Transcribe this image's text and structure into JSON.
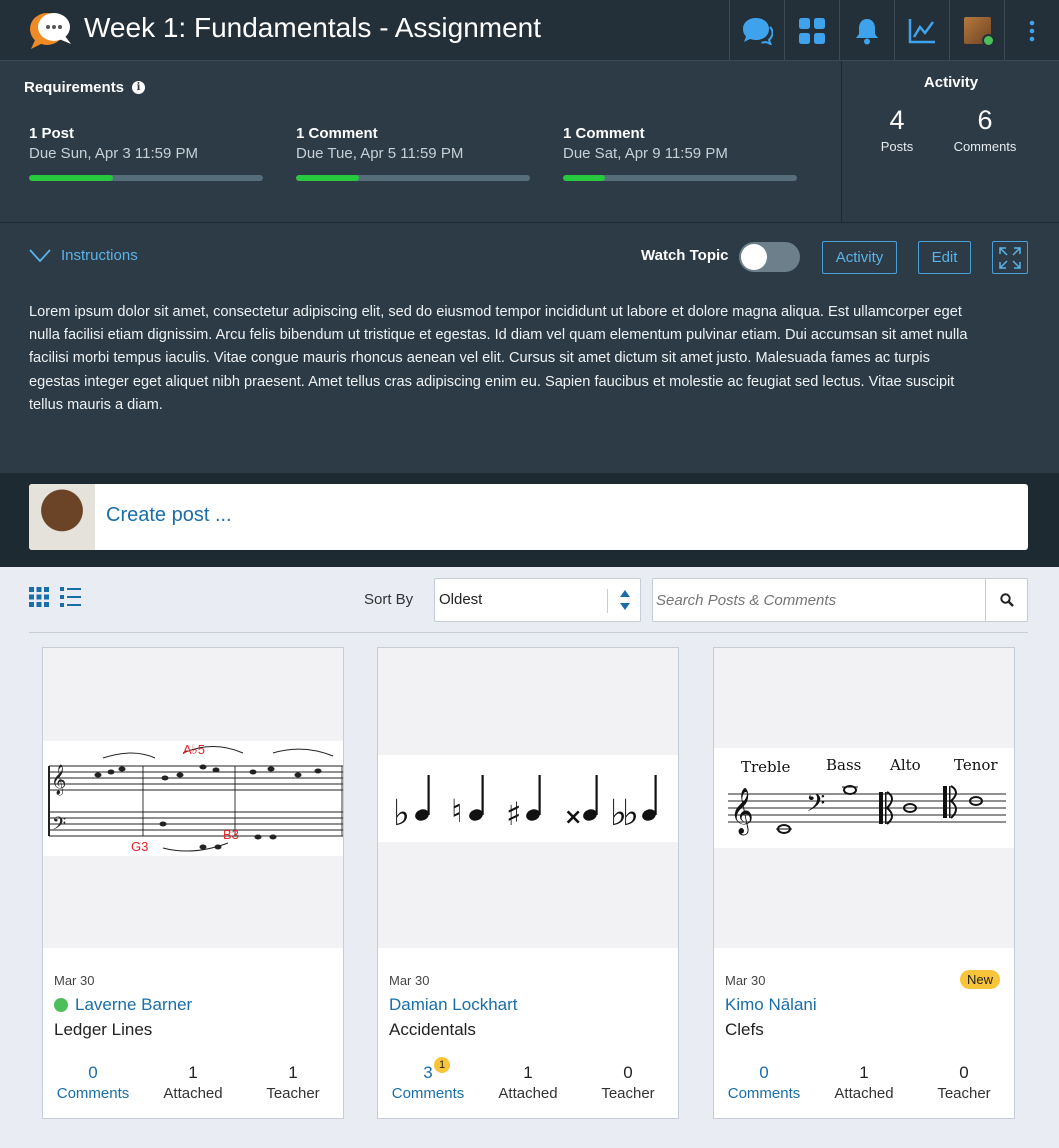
{
  "header": {
    "title": "Week 1: Fundamentals - Assignment",
    "icons": [
      "chat-icon",
      "dashboard-icon",
      "bell-icon",
      "analytics-icon",
      "user-avatar",
      "more-icon"
    ]
  },
  "requirements": {
    "title": "Requirements",
    "items": [
      {
        "name": "1 Post",
        "due": "Due Sun, Apr 3 11:59 PM",
        "progress": 0.36
      },
      {
        "name": "1 Comment",
        "due": "Due Tue, Apr 5 11:59 PM",
        "progress": 0.27
      },
      {
        "name": "1 Comment",
        "due": "Due Sat, Apr 9 11:59 PM",
        "progress": 0.18
      }
    ]
  },
  "activity": {
    "title": "Activity",
    "posts_count": "4",
    "posts_label": "Posts",
    "comments_count": "6",
    "comments_label": "Comments"
  },
  "instructions": {
    "toggle_label": "Instructions",
    "watch_label": "Watch Topic",
    "watch_on": false,
    "activity_button": "Activity",
    "edit_button": "Edit",
    "text": "Lorem ipsum dolor sit amet, consectetur adipiscing elit, sed do eiusmod tempor incididunt ut labore et dolore magna aliqua. Est ullamcorper eget nulla facilisi etiam dignissim. Arcu felis bibendum ut tristique et egestas. Id diam vel quam elementum pulvinar etiam. Dui accumsan sit amet nulla facilisi morbi tempus iaculis. Vitae congue mauris rhoncus aenean vel elit. Cursus sit amet dictum sit amet justo. Malesuada fames ac turpis egestas integer eget aliquet nibh praesent. Amet tellus cras adipiscing enim eu. Sapien faucibus et molestie ac feugiat sed lectus. Vitae suscipit tellus mauris a diam."
  },
  "create_post": {
    "label": "Create post ..."
  },
  "toolbar": {
    "sort_label": "Sort By",
    "sort_value": "Oldest",
    "search_placeholder": "Search Posts & Comments"
  },
  "posts": [
    {
      "date": "Mar 30",
      "author": "Laverne Barner",
      "online": true,
      "title": "Ledger Lines",
      "comments": "0",
      "comments_label": "Comments",
      "attached": "1",
      "attached_label": "Attached",
      "teacher": "1",
      "teacher_label": "Teacher",
      "image_labels": [
        "A♭5",
        "B3",
        "G3"
      ]
    },
    {
      "date": "Mar 30",
      "author": "Damian Lockhart",
      "online": false,
      "title": "Accidentals",
      "comments": "3",
      "comments_label": "Comments",
      "unread_badge": "1",
      "attached": "1",
      "attached_label": "Attached",
      "teacher": "0",
      "teacher_label": "Teacher"
    },
    {
      "date": "Mar 30",
      "author": "Kimo Nālani",
      "online": false,
      "title": "Clefs",
      "badge": "New",
      "comments": "0",
      "comments_label": "Comments",
      "attached": "1",
      "attached_label": "Attached",
      "teacher": "0",
      "teacher_label": "Teacher",
      "image_labels": [
        "Treble",
        "Bass",
        "Alto",
        "Tenor"
      ]
    }
  ],
  "colors": {
    "accent": "#1a6ea8",
    "progress": "#27c93f",
    "header_bg": "#233039",
    "panel_bg": "#2c3b46",
    "badge": "#f7c43a"
  }
}
